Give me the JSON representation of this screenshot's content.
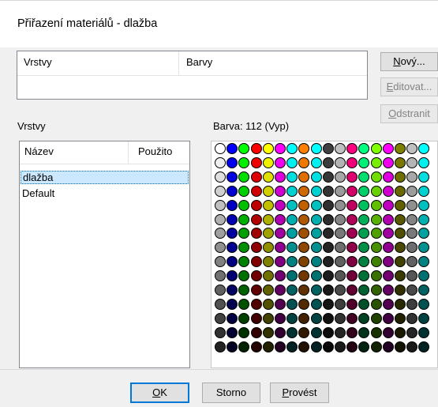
{
  "window": {
    "title": "Přiřazení materiálů - dlažba"
  },
  "assign_list": {
    "col_layers": "Vrstvy",
    "col_colors": "Barvy"
  },
  "side_buttons": {
    "new": {
      "accel": "N",
      "rest": "ový..."
    },
    "edit": {
      "accel": "E",
      "rest": "ditovat..."
    },
    "delete": {
      "accel": "O",
      "rest": "dstranit"
    }
  },
  "layers": {
    "label": "Vrstvy",
    "col_name": "Název",
    "col_used": "Použito",
    "items": [
      {
        "name": "dlažba",
        "selected": true
      },
      {
        "name": "Default",
        "selected": false
      }
    ]
  },
  "color": {
    "label": "Barva: 112  (Vyp)",
    "palette": {
      "base": [
        "#ffffff",
        "#0000ff",
        "#00ff00",
        "#ff0000",
        "#ffff00",
        "#ff00ff",
        "#00ffff",
        "#ff8000",
        "#00ffff",
        "#404040",
        "#c0c0c0",
        "#ff0080",
        "#00ff80",
        "#80ff00",
        "#ff00ff",
        "#808000",
        "#c0c0c0",
        "#00ffff"
      ],
      "rows": 15,
      "selected_index": 112
    }
  },
  "footer": {
    "ok": {
      "accel": "O",
      "rest": "K"
    },
    "cancel": "Storno",
    "apply": {
      "accel": "P",
      "rest": "rovést"
    }
  }
}
